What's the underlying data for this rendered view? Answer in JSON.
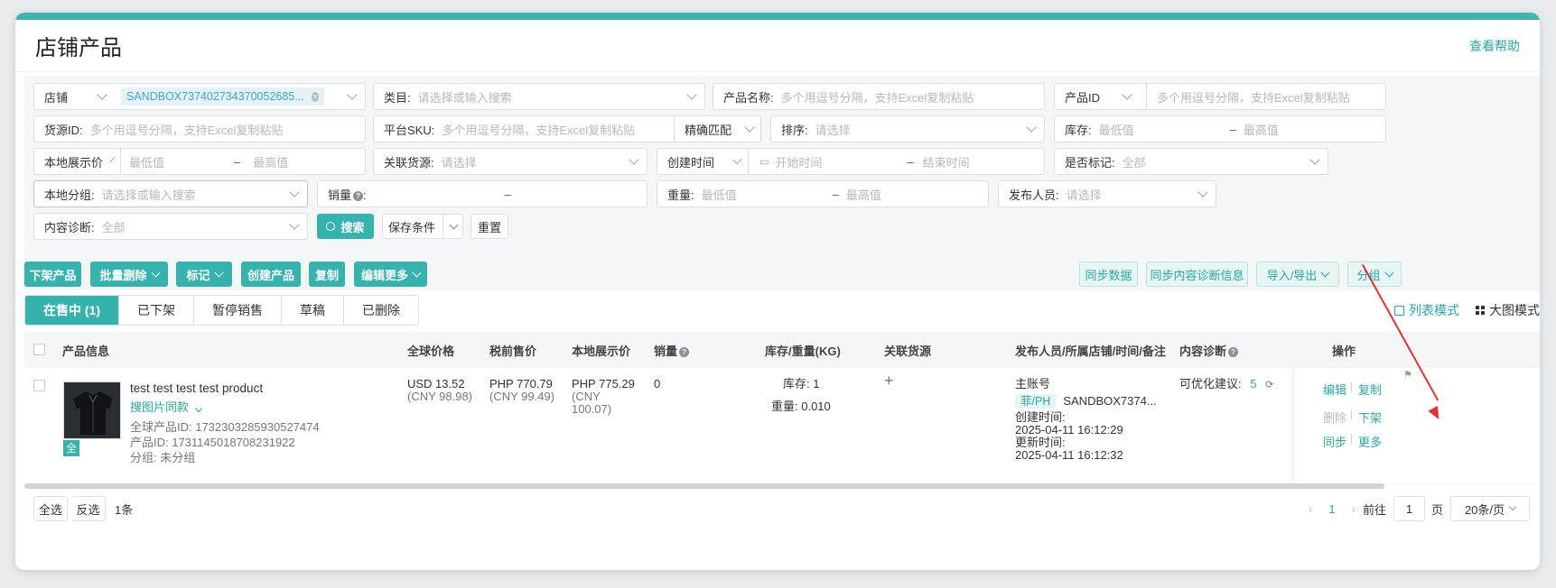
{
  "page": {
    "title": "店铺产品",
    "help": "查看帮助"
  },
  "filters": {
    "store_label": "店铺",
    "store_value": "SANDBOX737402734370052685...",
    "category_label": "类目:",
    "category_ph": "请选择或输入搜索",
    "product_name_label": "产品名称:",
    "product_name_ph": "多个用逗号分隔，支持Excel复制粘贴",
    "product_id_label": "产品ID",
    "product_id_ph": "多个用逗号分隔，支持Excel复制粘贴",
    "source_id_label": "货源ID:",
    "source_id_ph": "多个用逗号分隔，支持Excel复制粘贴",
    "platform_sku_label": "平台SKU:",
    "platform_sku_ph": "多个用逗号分隔，支持Excel复制粘贴",
    "match_mode": "精确匹配",
    "sort_label": "排序:",
    "sort_ph": "请选择",
    "stock_label": "库存:",
    "stock_min_ph": "最低值",
    "stock_max_ph": "最高值",
    "local_price_label": "本地展示价",
    "local_price_min_ph": "最低值",
    "local_price_max_ph": "最高值",
    "linked_source_label": "关联货源:",
    "linked_source_ph": "请选择",
    "created_time_label": "创建时间",
    "start_time_ph": "开始时间",
    "end_time_ph": "结束时间",
    "marked_label": "是否标记:",
    "marked_value": "全部",
    "local_group_label": "本地分组:",
    "local_group_ph": "请选择或输入搜索",
    "sales_label": "销量",
    "weight_label": "重量:",
    "weight_min_ph": "最低值",
    "weight_max_ph": "最高值",
    "publisher_label": "发布人员:",
    "publisher_ph": "请选择",
    "diagnosis_label": "内容诊断:",
    "diagnosis_value": "全部",
    "search_btn": "搜索",
    "save_btn": "保存条件",
    "reset_btn": "重置",
    "dash": "–"
  },
  "toolbar": {
    "delist": "下架产品",
    "batch_delete": "批量删除",
    "mark": "标记",
    "create": "创建产品",
    "copy": "复制",
    "edit_more": "编辑更多",
    "sync_data": "同步数据",
    "sync_content": "同步内容诊断信息",
    "import_export": "导入/导出",
    "group": "分组"
  },
  "tabs": [
    "在售中 (1)",
    "已下架",
    "暂停销售",
    "草稿",
    "已删除"
  ],
  "view_modes": {
    "list": "列表模式",
    "grid": "大图模式"
  },
  "table": {
    "headers": {
      "info": "产品信息",
      "global_price": "全球价格",
      "pretax": "税前售价",
      "local_price": "本地展示价",
      "sales": "销量",
      "stock_weight": "库存/重量(KG)",
      "linked": "关联货源",
      "publisher": "发布人员/所属店铺/时间/备注",
      "diagnosis": "内容诊断",
      "ops": "操作"
    },
    "row": {
      "name": "test test test test product",
      "image_search": "搜图片同款",
      "global_id": "全球产品ID:  1732303285930527474",
      "product_id": "产品ID:  1731145018708231922",
      "group": "分组:  未分组",
      "badge": "全",
      "global_price": "USD 13.52",
      "global_price_cny": "(CNY 98.98)",
      "pretax": "PHP 770.79",
      "pretax_cny": "(CNY 99.49)",
      "local_price": "PHP 775.29",
      "local_price_cny_1": "(CNY",
      "local_price_cny_2": "100.07)",
      "sales": "0",
      "stock": "库存:  1",
      "weight": "重量:  0.010",
      "linked_add": "+",
      "publisher": "主账号",
      "region": "菲/PH",
      "store": "SANDBOX7374...",
      "created_label": "创建时间:",
      "created": "2025-04-11 16:12:29",
      "updated_label": "更新时间:",
      "updated": "2025-04-11 16:12:32",
      "diagnosis_label": "可优化建议:",
      "diagnosis_count": "5",
      "ops": {
        "edit": "编辑",
        "copy": "复制",
        "delete": "删除",
        "delist": "下架",
        "sync": "同步",
        "more": "更多"
      }
    }
  },
  "footer": {
    "select_all": "全选",
    "invert": "反选",
    "count": "1条",
    "page": "1",
    "goto": "前往",
    "goto_value": "1",
    "page_unit": "页",
    "page_size": "20条/页"
  },
  "colors": {
    "accent": "#36b3ae",
    "annotation": "#e53030"
  }
}
